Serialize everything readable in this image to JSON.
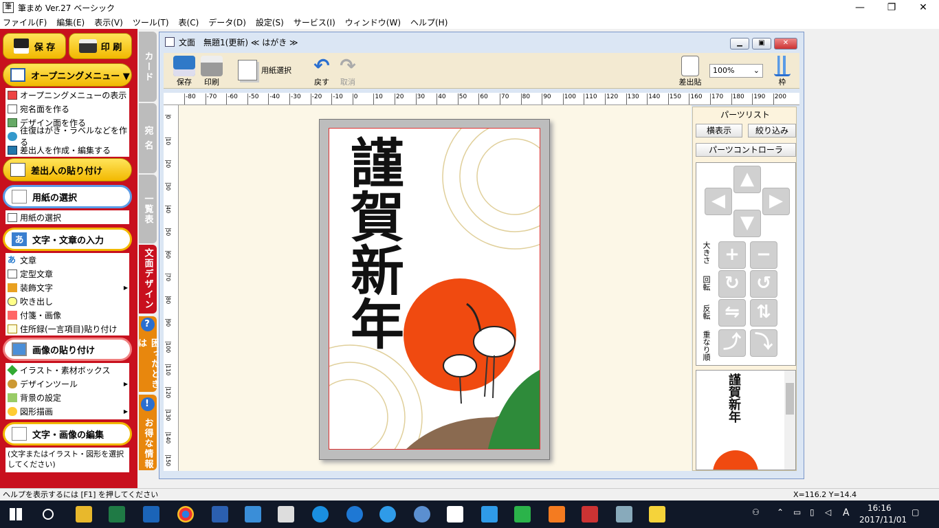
{
  "window": {
    "title": "筆まめ Ver.27 ベーシック",
    "app_icon": "fude-icon"
  },
  "menu": [
    "ファイル(F)",
    "編集(E)",
    "表示(V)",
    "ツール(T)",
    "表(C)",
    "データ(D)",
    "設定(S)",
    "サービス(I)",
    "ウィンドウ(W)",
    "ヘルプ(H)"
  ],
  "left": {
    "save": "保 存",
    "print": "印 刷",
    "opening": {
      "header": "オープニングメニュー ▼",
      "items": [
        "オープニングメニューの表示",
        "宛名面を作る",
        "デザイン面を作る",
        "往復はがき・ラベルなどを作る",
        "差出人を作成・編集する"
      ]
    },
    "sender_paste": "差出人の貼り付け",
    "paper": {
      "header": "用紙の選択",
      "items": [
        "用紙の選択"
      ]
    },
    "text": {
      "header": "文字・文章の入力",
      "items": [
        "文章",
        "定型文章",
        "装飾文字",
        "吹き出し",
        "付箋・画像",
        "住所録(一言項目)貼り付け"
      ]
    },
    "image": {
      "header": "画像の貼り付け",
      "items": [
        "イラスト・素材ボックス",
        "デザインツール",
        "背景の設定",
        "図形描画"
      ]
    },
    "edit": {
      "header": "文字・画像の編集",
      "note": "(文字またはイラスト・図形を選択してください)"
    }
  },
  "tabs": [
    "カード",
    "宛 名",
    "一覧表",
    "文面デザイン",
    "困ったときは",
    "お得な情報"
  ],
  "doc": {
    "title": "文面　無題1(更新) ≪ はがき ≫",
    "toolbar": {
      "save": "保存",
      "print": "印刷",
      "paper_select": "用紙選択",
      "undo": "戻す",
      "redo": "取消",
      "sender": "差出貼",
      "zoom": "100%",
      "frame": "枠"
    },
    "ruler_h": [
      "-80",
      "-70",
      "-60",
      "-50",
      "-40",
      "-30",
      "-20",
      "-10",
      "0",
      "10",
      "20",
      "30",
      "40",
      "50",
      "60",
      "70",
      "80",
      "90",
      "100",
      "110",
      "120",
      "130",
      "140",
      "150",
      "160",
      "170",
      "180",
      "190",
      "200"
    ],
    "ruler_v": [
      "0",
      "10",
      "20",
      "30",
      "40",
      "50",
      "60",
      "70",
      "80",
      "90",
      "100",
      "110",
      "120",
      "130",
      "140",
      "150"
    ]
  },
  "card_text": "謹賀新年",
  "parts": {
    "title": "パーツリスト",
    "horizontal": "横表示",
    "filter": "絞り込み",
    "controller": "パーツコントローラ",
    "size": "大きさ",
    "rotate": "回転",
    "flip": "反転",
    "order": "重なり順"
  },
  "status": {
    "help": "ヘルプを表示するには [F1] を押してください",
    "coords": "X=116.2 Y=14.4"
  },
  "taskbar": {
    "time": "16:16",
    "date": "2017/11/01",
    "ime": "A"
  },
  "colors": {
    "sidebar_red": "#c8101e",
    "button_yellow": "#f2b800",
    "sun": "#f04a10",
    "canvas": "#fcf7e7"
  }
}
